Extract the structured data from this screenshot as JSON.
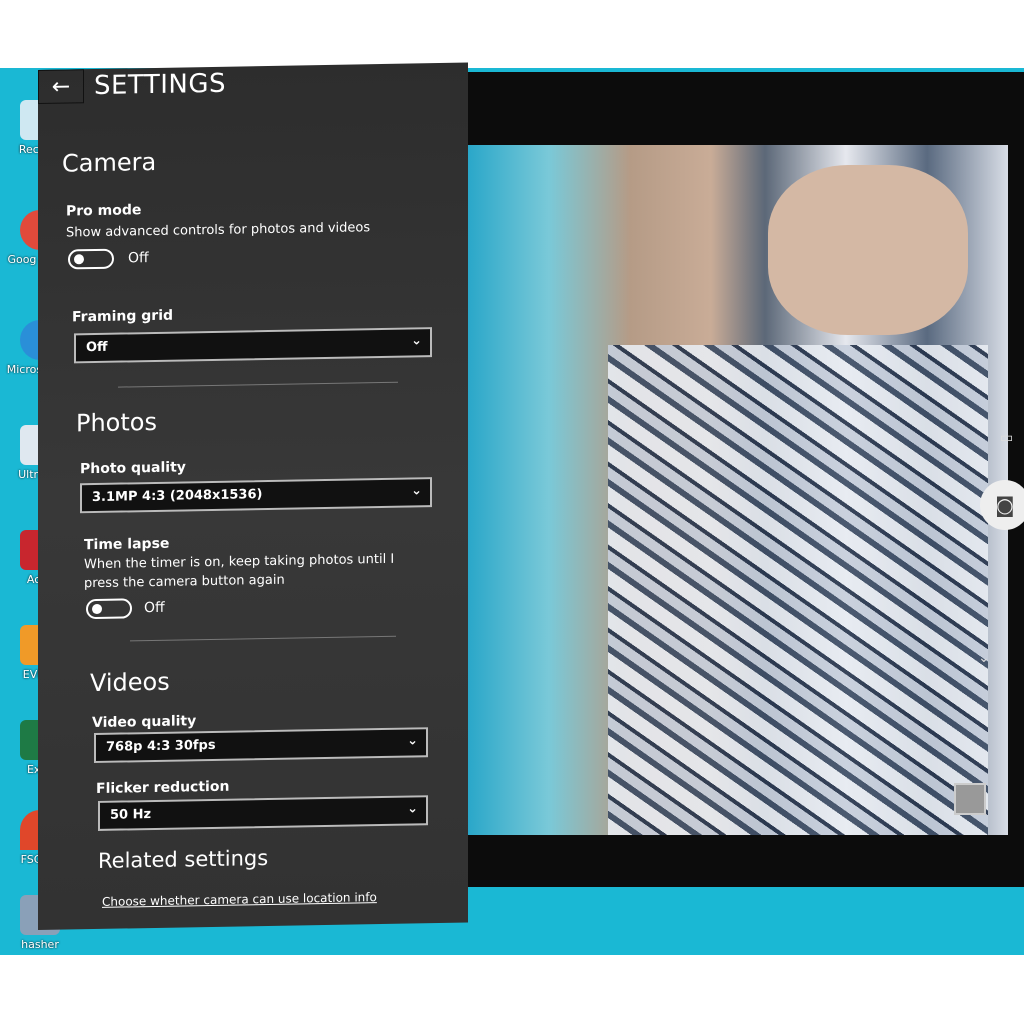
{
  "desktop_icons": [
    {
      "label": "Recycle",
      "color": "#cfe8f2"
    },
    {
      "label": "Goog Chron",
      "color": "#e14a3b"
    },
    {
      "label": "Micros Edge",
      "color": "#2a8fd8"
    },
    {
      "label": "UltraVie",
      "color": "#dfe8f0"
    },
    {
      "label": "Acce",
      "color": "#c8262e"
    },
    {
      "label": "EVKey",
      "color": "#f09a28"
    },
    {
      "label": "Exce",
      "color": "#1e7a45"
    },
    {
      "label": "FSCapt",
      "color": "#e0472a"
    },
    {
      "label": "hasher",
      "color": "#8aa0b8"
    }
  ],
  "settings": {
    "back_icon": "arrow-left",
    "title": "SETTINGS",
    "camera": {
      "heading": "Camera",
      "pro_mode_label": "Pro mode",
      "pro_mode_desc": "Show advanced controls for photos and videos",
      "pro_mode_state": "Off",
      "framing_grid_label": "Framing grid",
      "framing_grid_value": "Off"
    },
    "photos": {
      "heading": "Photos",
      "photo_quality_label": "Photo quality",
      "photo_quality_value": "3.1MP 4:3 (2048x1536)",
      "time_lapse_label": "Time lapse",
      "time_lapse_desc": "When the timer is on, keep taking photos until I press the camera button again",
      "time_lapse_state": "Off"
    },
    "videos": {
      "heading": "Videos",
      "video_quality_label": "Video quality",
      "video_quality_value": "768p 4:3 30fps",
      "flicker_label": "Flicker reduction",
      "flicker_value": "50 Hz"
    },
    "related": {
      "heading": "Related settings",
      "location_link": "Choose whether camera can use location info"
    }
  },
  "camera_controls": {
    "video_icon": "video-camera",
    "shutter_icon": "camera",
    "chevron_icon": "chevron-down"
  }
}
